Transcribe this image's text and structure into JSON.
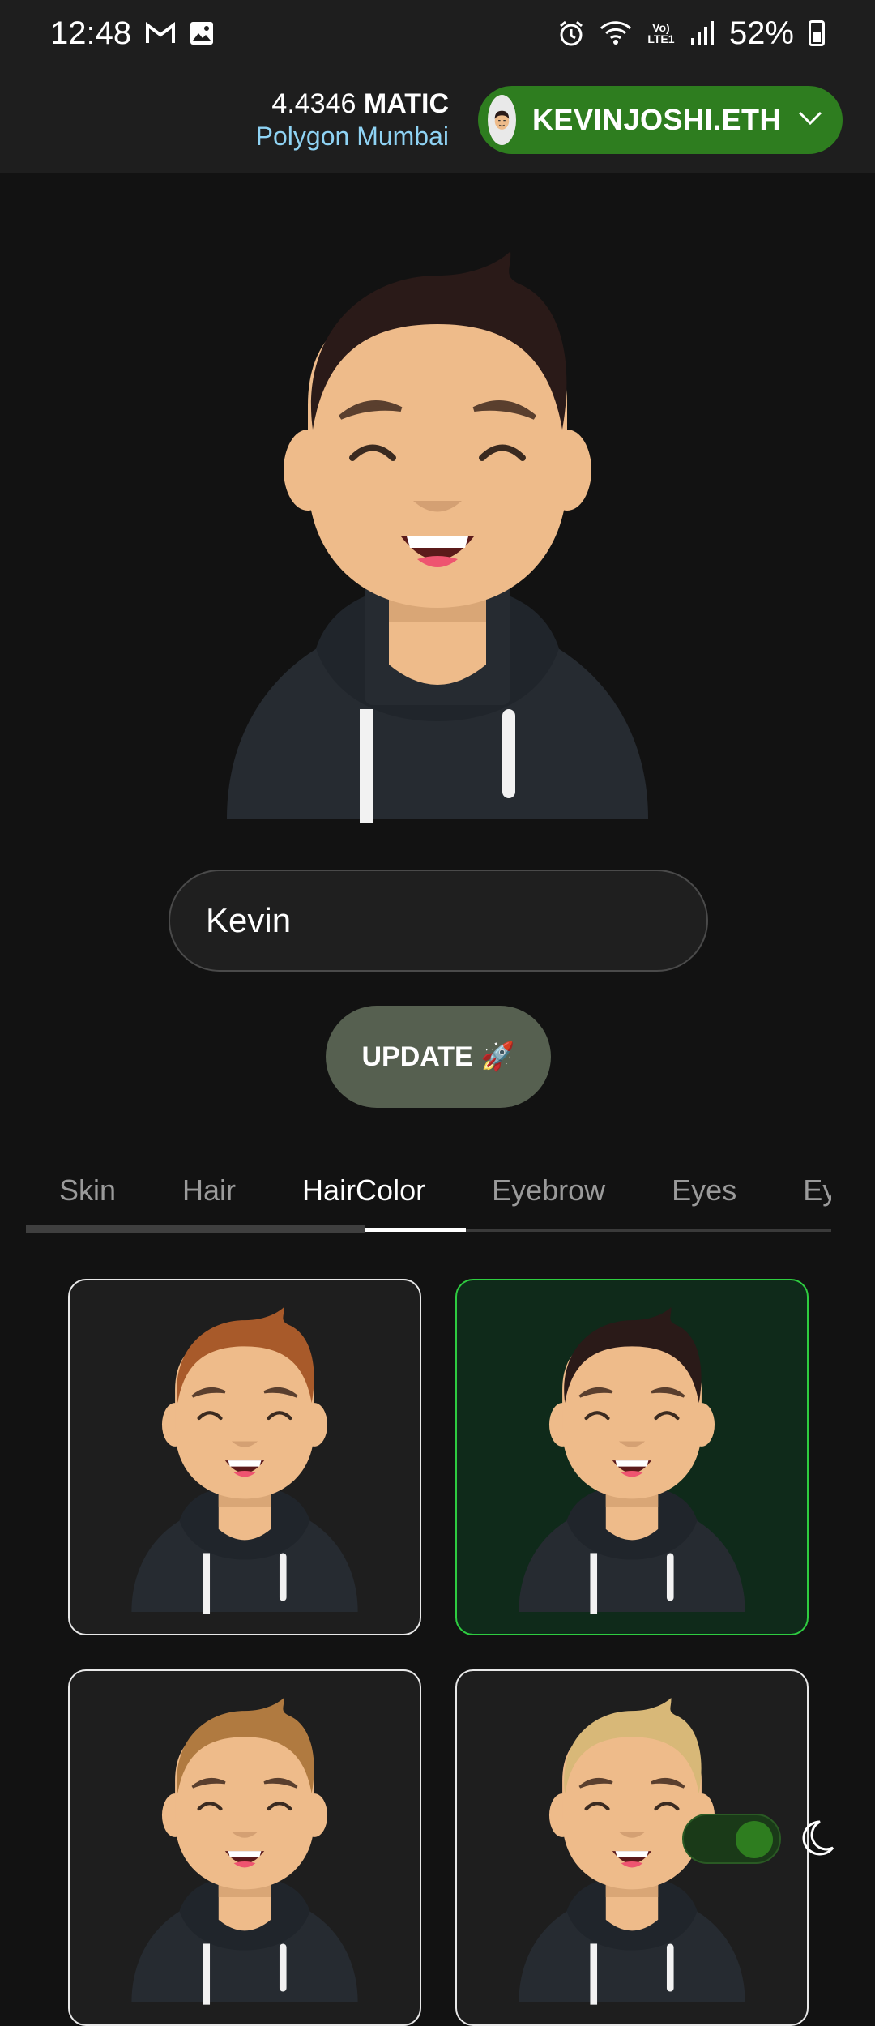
{
  "status_bar": {
    "time": "12:48",
    "battery": "52%",
    "network_label": "Vo) LTE1"
  },
  "header": {
    "balance_amount": "4.4346",
    "balance_unit": "MATIC",
    "network": "Polygon Mumbai",
    "account": "KEVINJOSHI.ETH"
  },
  "form": {
    "name_value": "Kevin",
    "update_label": "UPDATE 🚀"
  },
  "tabs": [
    {
      "label": "Skin"
    },
    {
      "label": "Hair"
    },
    {
      "label": "HairColor"
    },
    {
      "label": "Eyebrow"
    },
    {
      "label": "Eyes"
    },
    {
      "label": "Ey"
    }
  ],
  "active_tab": "HairColor",
  "hair_options": [
    {
      "color": "#a85a2a",
      "selected": false
    },
    {
      "color": "#2a1a18",
      "selected": true
    },
    {
      "color": "#b07a40",
      "selected": false
    },
    {
      "color": "#d8b878",
      "selected": false
    }
  ],
  "colors": {
    "accent_green": "#2e7d1f",
    "selected_border": "#2ecc40",
    "skin": "#eebb8a",
    "hoodie": "#262b31",
    "main_hair": "#2a1a18"
  },
  "theme": {
    "dark_mode": true
  }
}
